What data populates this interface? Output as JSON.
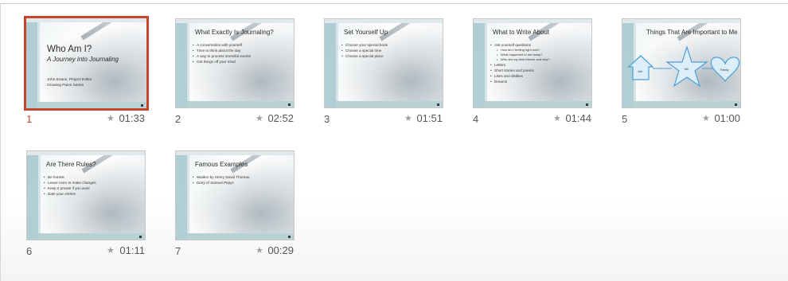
{
  "slides": [
    {
      "number": "1",
      "duration": "01:33",
      "selected": true,
      "title": "Who Am I?",
      "subtitle": "A Journey into Journaling",
      "lines": [
        "John Evans, Project Editor",
        "Growing Pains Series"
      ]
    },
    {
      "number": "2",
      "duration": "02:52",
      "title": "What Exactly Is Journaling?",
      "bullets": [
        "A conversation with yourself",
        "Time to think about the day",
        "A way to process stressful events",
        "Get things off your mind"
      ]
    },
    {
      "number": "3",
      "duration": "01:51",
      "title": "Set Yourself Up",
      "bullets": [
        "Choose your special book",
        "Choose a special time",
        "Choose a special place"
      ]
    },
    {
      "number": "4",
      "duration": "01:44",
      "title": "What to Write About",
      "bullets": [
        "Ask yourself questions",
        "Letters",
        "Short stories and poems",
        "Likes and dislikes",
        "Dreams"
      ],
      "sub_bullets": [
        "How am I feeling right now?",
        "What happened to me today?",
        "Who are my best friends and why?"
      ]
    },
    {
      "number": "5",
      "duration": "01:00",
      "title": "Things That Are Important to Me",
      "shapes": [
        "Job",
        "Me",
        "Family"
      ]
    },
    {
      "number": "6",
      "duration": "01:11",
      "title": "Are There Rules?",
      "bullets": [
        "Be honest",
        "Leave room to make changes",
        "Keep it private if you want",
        "Date your entries"
      ]
    },
    {
      "number": "7",
      "duration": "00:29",
      "title": "Famous Examples",
      "bullets": [
        "Walden by Henry David Thoreau",
        "Diary of Samuel Pepys"
      ]
    }
  ],
  "icons": {
    "duration_icon": "star-icon"
  },
  "colors": {
    "selection": "#c6452d",
    "accent": "#a9c9cf",
    "shape_fill": "#dbeefa",
    "shape_stroke": "#4c9fd6"
  }
}
